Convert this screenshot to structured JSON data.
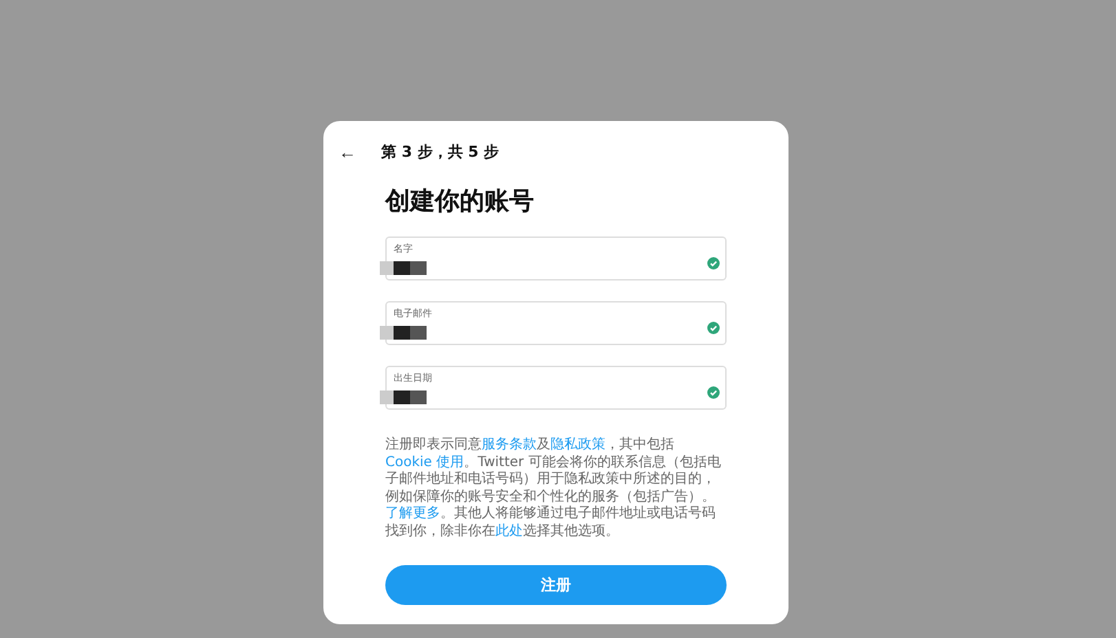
{
  "header": {
    "back": "←",
    "step": "第 3 步，共 5 步"
  },
  "title": "创建你的账号",
  "fields": [
    {
      "label": "名字",
      "valid": true
    },
    {
      "label": "电子邮件",
      "valid": true
    },
    {
      "label": "出生日期",
      "valid": true
    }
  ],
  "terms": [
    {
      "text": "注册即表示同意",
      "link": false
    },
    {
      "text": "服务条款",
      "link": true
    },
    {
      "text": "及",
      "link": false
    },
    {
      "text": "隐私政策",
      "link": true
    },
    {
      "text": "，其中包括 ",
      "link": false
    },
    {
      "text": "Cookie 使用",
      "link": true
    },
    {
      "text": "。Twitter 可能会将你的联系信息（包括电子邮件地址和电话号码）用于隐私政策中所述的目的，例如保障你的账号安全和个性化的服务（包括广告）。",
      "link": false
    },
    {
      "text": "了解更多",
      "link": true
    },
    {
      "text": "。其他人将能够通过电子邮件地址或电话号码找到你，除非你在",
      "link": false
    },
    {
      "text": "此处",
      "link": true
    },
    {
      "text": "选择其他选项。",
      "link": false
    }
  ],
  "submit": "注册"
}
